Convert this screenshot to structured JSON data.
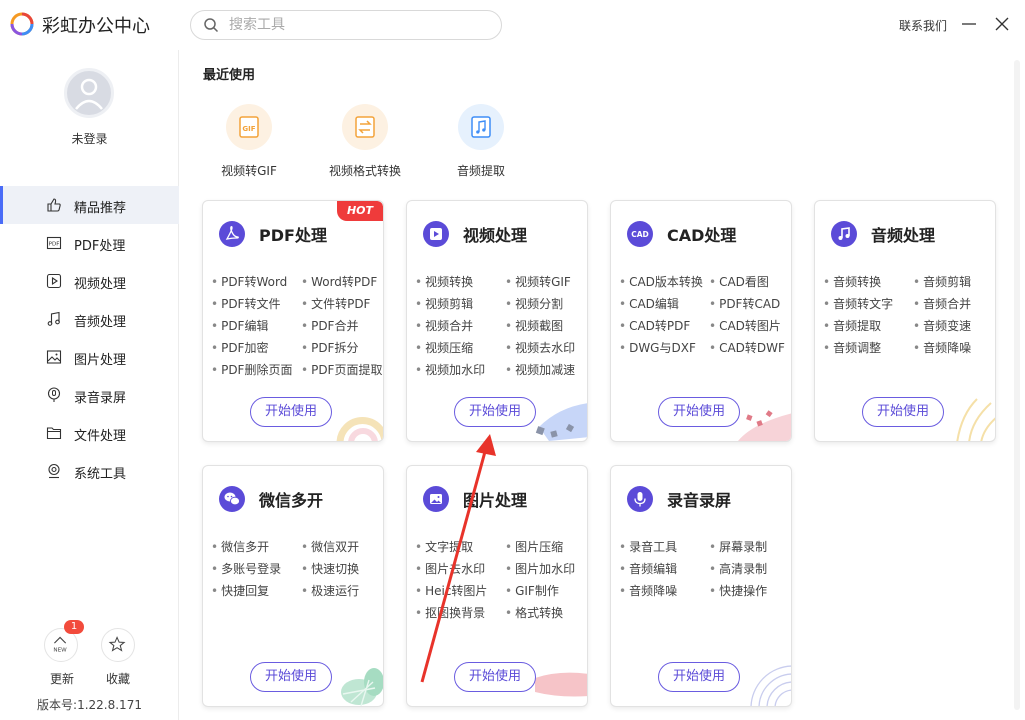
{
  "app": {
    "title": "彩虹办公中心"
  },
  "search": {
    "placeholder": "搜索工具"
  },
  "header": {
    "contact": "联系我们"
  },
  "user": {
    "status": "未登录"
  },
  "sidebar": {
    "items": [
      {
        "label": "精品推荐",
        "icon": "thumbs-up-icon",
        "active": true
      },
      {
        "label": "PDF处理",
        "icon": "pdf-icon"
      },
      {
        "label": "视频处理",
        "icon": "play-icon"
      },
      {
        "label": "音频处理",
        "icon": "music-note-icon"
      },
      {
        "label": "图片处理",
        "icon": "image-icon"
      },
      {
        "label": "录音录屏",
        "icon": "microphone-icon"
      },
      {
        "label": "文件处理",
        "icon": "folder-icon"
      },
      {
        "label": "系统工具",
        "icon": "monitor-icon"
      }
    ],
    "update_label": "更新",
    "update_badge": "1",
    "favorite_label": "收藏",
    "version": "版本号:1.22.8.171"
  },
  "recent": {
    "title": "最近使用",
    "items": [
      {
        "label": "视频转GIF",
        "icon": "gif-icon"
      },
      {
        "label": "视频格式转换",
        "icon": "convert-icon"
      },
      {
        "label": "音频提取",
        "icon": "audio-file-icon"
      }
    ]
  },
  "cards": [
    {
      "title": "PDF处理",
      "icon": "pdf-icon",
      "hot": "HOT",
      "features": [
        "PDF转Word",
        "Word转PDF",
        "PDF转文件",
        "文件转PDF",
        "PDF编辑",
        "PDF合并",
        "PDF加密",
        "PDF拆分",
        "PDF删除页面",
        "PDF页面提取"
      ],
      "button": "开始使用"
    },
    {
      "title": "视频处理",
      "icon": "play-icon",
      "features": [
        "视频转换",
        "视频转GIF",
        "视频剪辑",
        "视频分割",
        "视频合并",
        "视频截图",
        "视频压缩",
        "视频去水印",
        "视频加水印",
        "视频加减速"
      ],
      "button": "开始使用"
    },
    {
      "title": "CAD处理",
      "icon": "cad-icon",
      "features": [
        "CAD版本转换",
        "CAD看图",
        "CAD编辑",
        "PDF转CAD",
        "CAD转PDF",
        "CAD转图片",
        "DWG与DXF",
        "CAD转DWF"
      ],
      "button": "开始使用"
    },
    {
      "title": "音频处理",
      "icon": "music-note-icon",
      "features": [
        "音频转换",
        "音频剪辑",
        "音频转文字",
        "音频合并",
        "音频提取",
        "音频变速",
        "音频调整",
        "音频降噪"
      ],
      "button": "开始使用"
    },
    {
      "title": "微信多开",
      "icon": "wechat-icon",
      "features": [
        "微信多开",
        "微信双开",
        "多账号登录",
        "快速切换",
        "快捷回复",
        "极速运行"
      ],
      "button": "开始使用"
    },
    {
      "title": "图片处理",
      "icon": "image-icon",
      "features": [
        "文字提取",
        "图片压缩",
        "图片去水印",
        "图片加水印",
        "Heic转图片",
        "GIF制作",
        "抠图换背景",
        "格式转换"
      ],
      "button": "开始使用"
    },
    {
      "title": "录音录屏",
      "icon": "microphone-icon",
      "features": [
        "录音工具",
        "屏幕录制",
        "音频编辑",
        "高清录制",
        "音频降噪",
        "快捷操作"
      ],
      "button": "开始使用"
    }
  ],
  "colors": {
    "accent": "#5b4bd8",
    "hot": "#ef3b3b",
    "badge": "#f24b3c",
    "active_bar": "#4a6cf7",
    "annotation_arrow": "#e8332a"
  }
}
